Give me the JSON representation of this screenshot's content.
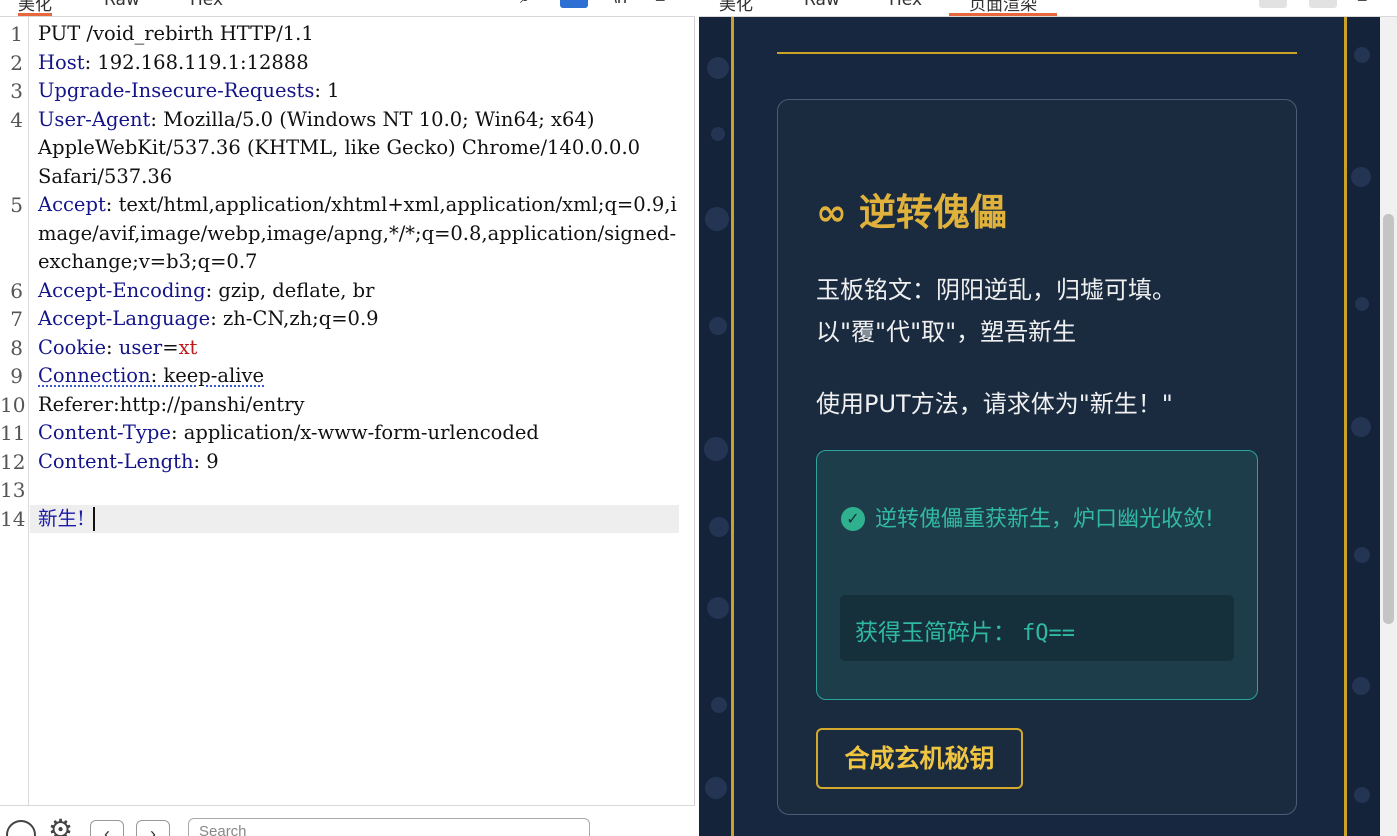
{
  "left_tabs": [
    "美化",
    "Raw",
    "Hex"
  ],
  "right_tabs": [
    "美化",
    "Raw",
    "Hex",
    "页面渲染"
  ],
  "request": {
    "lines": [
      {
        "num": "1",
        "header": "",
        "value": "PUT /void_rebirth HTTP/1.1"
      },
      {
        "num": "2",
        "header": "Host",
        "value": ": 192.168.119.1:12888"
      },
      {
        "num": "3",
        "header": "Upgrade-Insecure-Requests",
        "value": ": 1"
      },
      {
        "num": "4",
        "header": "User-Agent",
        "value": ": Mozilla/5.0 (Windows NT 10.0; Win64; x64) AppleWebKit/537.36 (KHTML, like Gecko) Chrome/140.0.0.0 Safari/537.36"
      },
      {
        "num": "5",
        "header": "Accept",
        "value": ": text/html,application/xhtml+xml,application/xml;q=0.9,image/avif,image/webp,image/apng,*/*;q=0.8,application/signed-exchange;v=b3;q=0.7"
      },
      {
        "num": "6",
        "header": "Accept-Encoding",
        "value": ": gzip, deflate, br"
      },
      {
        "num": "7",
        "header": "Accept-Language",
        "value": ": zh-CN,zh;q=0.9"
      },
      {
        "num": "8",
        "header": "Cookie",
        "value": ": ",
        "cookie_key": "user",
        "cookie_eq": "=",
        "cookie_val": "xt"
      },
      {
        "num": "9",
        "header": "Connection",
        "value": ": keep-alive"
      },
      {
        "num": "10",
        "header": "",
        "value": "Referer:http://panshi/entry"
      },
      {
        "num": "11",
        "header": "Content-Type",
        "value": ": application/x-www-form-urlencoded"
      },
      {
        "num": "12",
        "header": "Content-Length",
        "value": ": 9"
      },
      {
        "num": "13",
        "header": "",
        "value": ""
      },
      {
        "num": "14",
        "header": "",
        "value": "新生!"
      }
    ]
  },
  "search": {
    "placeholder": "Search"
  },
  "rendered": {
    "title_icon": "∞",
    "title": "逆转傀儡",
    "desc_line1": "玉板铭文：阴阳逆乱，归墟可填。",
    "desc_line2": "以\"覆\"代\"取\"，塑吾新生",
    "desc_line3": "使用PUT方法，请求体为\"新生！\"",
    "success_message": "逆转傀儡重获新生，炉口幽光收敛!",
    "fragment_label": "获得玉简碎片：",
    "fragment_value": "fQ==",
    "button_label": "合成玄机秘钥"
  },
  "colors": {
    "accent_tab": "#e8673c",
    "gold": "#c9a227",
    "teal": "#2fb9a4",
    "bg_dark": "#14223a"
  }
}
